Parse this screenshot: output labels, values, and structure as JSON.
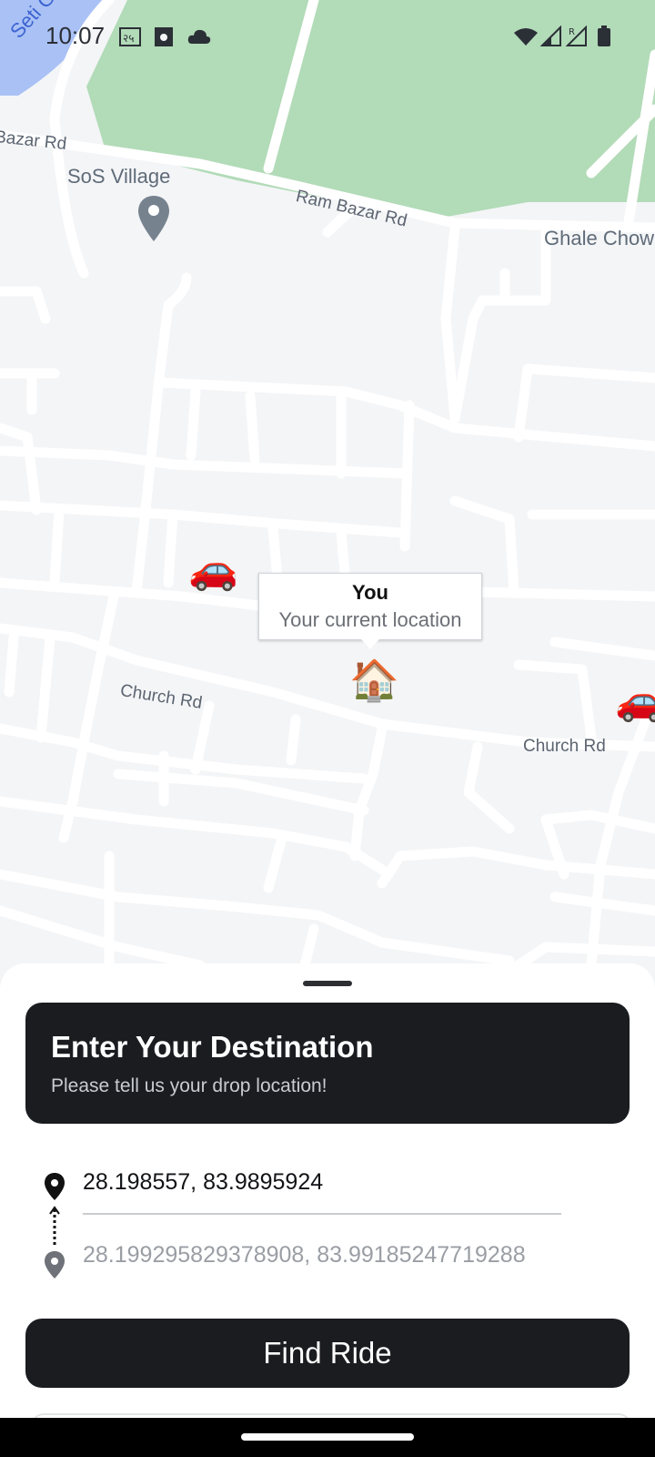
{
  "status_bar": {
    "time": "10:07",
    "icons_left": [
      "app-badge-icon",
      "sim-icon",
      "cloud-icon"
    ],
    "icons_right": [
      "wifi-icon",
      "signal-icon",
      "roaming-signal-icon",
      "battery-icon"
    ]
  },
  "map": {
    "place_labels": [
      "Seti Ganga",
      "SoS Village",
      "Ghale Chow"
    ],
    "street_labels": [
      "Bazar Rd",
      "Ram Bazar Rd",
      "Church Rd",
      "Church Rd"
    ],
    "marker": {
      "title": "You",
      "subtitle": "Your current location",
      "icon": "house-icon"
    },
    "vehicle_icons": [
      "car-icon",
      "car-icon"
    ],
    "colors": {
      "park": "#b2dbb8",
      "water": "#a9c1f5",
      "road": "#ffffff",
      "land": "#f4f5f7"
    }
  },
  "sheet": {
    "card": {
      "title": "Enter Your Destination",
      "subtitle": "Please tell us your drop location!"
    },
    "pickup_value": "28.198557, 83.9895924",
    "drop_value": "28.199295829378908, 83.99185247719288",
    "find_button": "Find Ride"
  }
}
